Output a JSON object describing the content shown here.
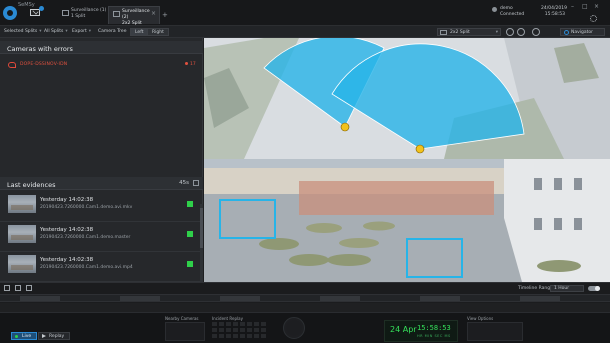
{
  "app": {
    "name": "SeMSy"
  },
  "window_tabs": [
    {
      "title": "Surveillance (1)",
      "subtitle": "1 Split"
    },
    {
      "title": "Surveillance (2)",
      "subtitle": "2x2 Split"
    }
  ],
  "user": {
    "name": "demo",
    "status": "Connected",
    "date": "24/04/2019",
    "time": "15:58:53"
  },
  "toolbar": {
    "selected_splits": "Selected Splits",
    "all_splits": "All Splits",
    "export": "Export",
    "camera_tree": "Camera Tree",
    "left": "Left",
    "right": "Right",
    "split_layout": "2x2 Split",
    "navigator": "Navigator"
  },
  "cameras_errors": {
    "title": "Cameras with errors",
    "items": [
      {
        "name": "DOPE-DSSINOV-IDN",
        "count": "17"
      }
    ]
  },
  "evidences": {
    "title": "Last evidences",
    "count": "45s",
    "items": [
      {
        "time": "Yesterday  14:02:38",
        "file": "20190423.7260000.Cam1.demo.avi.mkv"
      },
      {
        "time": "Yesterday  14:02:38",
        "file": "20190423.7260000.Cam1.demo.master"
      },
      {
        "time": "Yesterday  14:02:38",
        "file": "20190423.7260000.Cam1.demo.avi.mp4"
      }
    ]
  },
  "timeline": {
    "range_label": "Timeline Range",
    "range_value": "1 Hour"
  },
  "bottom": {
    "live": "Live",
    "replay": "Replay",
    "nearby_cameras": "Nearby Cameras",
    "history": "Incident Replay",
    "view_options": "View Options",
    "clock_date": "24 Apr",
    "clock_time": "15:58:53",
    "clock_sub": "HR  MIN  SEC  MS"
  },
  "colors": {
    "accent": "#2a8ad4",
    "error": "#e1513f",
    "ok": "#2fd04a",
    "overlay": "#27b4e8"
  }
}
